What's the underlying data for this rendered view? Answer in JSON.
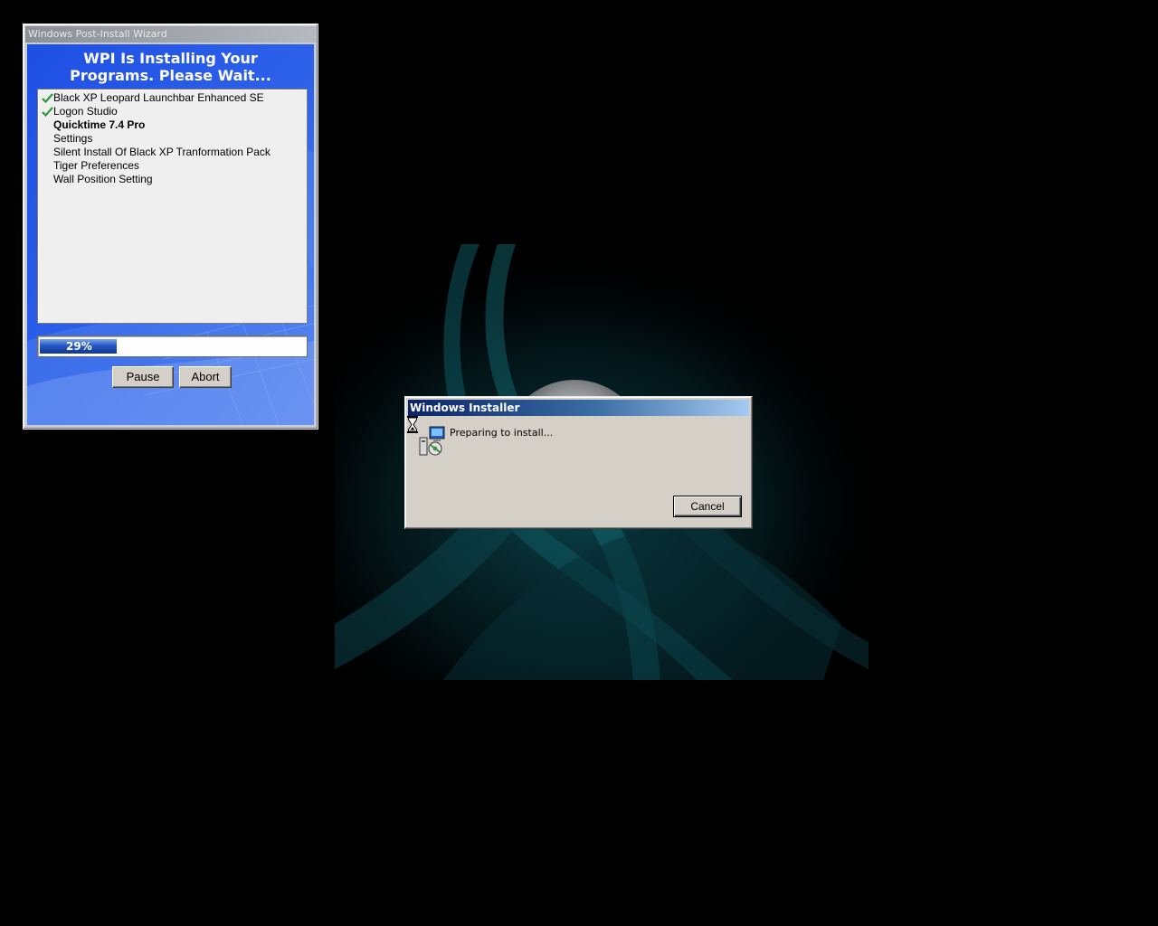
{
  "wpi_window": {
    "title": "Windows Post-Install Wizard",
    "heading_line1": "WPI Is Installing Your",
    "heading_line2": "Programs. Please Wait...",
    "programs": [
      {
        "label": "Black XP Leopard Launchbar Enhanced SE",
        "status": "done"
      },
      {
        "label": "Logon Studio",
        "status": "done"
      },
      {
        "label": "Quicktime 7.4 Pro",
        "status": "current"
      },
      {
        "label": "Settings",
        "status": "pending"
      },
      {
        "label": "Silent Install Of Black XP Tranformation Pack",
        "status": "pending"
      },
      {
        "label": "Tiger Preferences",
        "status": "pending"
      },
      {
        "label": "Wall Position Setting",
        "status": "pending"
      }
    ],
    "progress_percent": 29,
    "progress_text": "29%",
    "pause_label": "Pause",
    "abort_label": "Abort",
    "accent_color": "#2a58e0"
  },
  "installer_dialog": {
    "title": "Windows Installer",
    "message": "Preparing to install...",
    "cancel_label": "Cancel",
    "title_color": "#0a246a"
  },
  "icons": {
    "check": "checkmark-icon",
    "hourglass": "hourglass-icon",
    "installer": "installer-package-icon"
  }
}
